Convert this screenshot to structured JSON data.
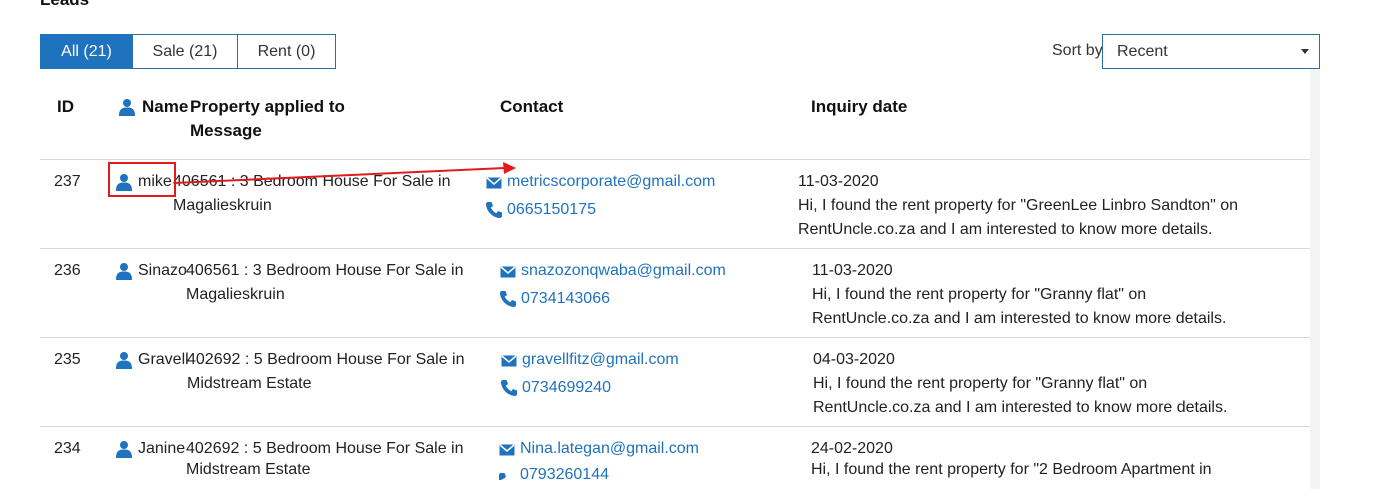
{
  "page_title": "Leads",
  "tabs": [
    {
      "label": "All (21)",
      "active": true
    },
    {
      "label": "Sale (21)",
      "active": false
    },
    {
      "label": "Rent (0)",
      "active": false
    }
  ],
  "sort": {
    "label": "Sort by",
    "selected": "Recent"
  },
  "columns": {
    "id": "ID",
    "name": "Name",
    "property": "Property applied to",
    "message": "Message",
    "contact": "Contact",
    "inquiry_date": "Inquiry date"
  },
  "rows": [
    {
      "id": "237",
      "name": "mike",
      "property_line1": "406561 : 3 Bedroom House For Sale in",
      "property_line2": "Magalieskruin",
      "email": "metricscorporate@gmail.com",
      "phone": "0665150175",
      "date": "11-03-2020",
      "message_line1": "Hi, I found the rent property for \"GreenLee Linbro Sandton\" on",
      "message_line2": "RentUncle.co.za and I am interested to know more details."
    },
    {
      "id": "236",
      "name": "Sinazo",
      "property_line1": "406561 : 3 Bedroom House For Sale in",
      "property_line2": "Magalieskruin",
      "email": "snazozonqwaba@gmail.com",
      "phone": "0734143066",
      "date": "11-03-2020",
      "message_line1": "Hi, I found the rent property for \"Granny flat\" on",
      "message_line2": "RentUncle.co.za and I am interested to know more details."
    },
    {
      "id": "235",
      "name": "Gravell",
      "property_line1": "402692 : 5 Bedroom House For Sale in",
      "property_line2": "Midstream Estate",
      "email": "gravellfitz@gmail.com",
      "phone": "0734699240",
      "date": "04-03-2020",
      "message_line1": "Hi, I found the rent property for \"Granny flat\" on",
      "message_line2": "RentUncle.co.za and I am interested to know more details."
    },
    {
      "id": "234",
      "name": "Janine",
      "property_line1": "402692 : 5 Bedroom House For Sale in",
      "property_line2": "Midstream Estate",
      "email": "Nina.lategan@gmail.com",
      "phone": "0793260144",
      "date": "24-02-2020",
      "message_line1": "Hi, I found the rent property for \"2 Bedroom Apartment in",
      "message_line2": ""
    }
  ],
  "colors": {
    "accent": "#1f72bd",
    "annotation": "#e01b1b",
    "panel": "#f2f3f5"
  },
  "icons": [
    "user-icon",
    "mail-icon",
    "phone-icon",
    "chevron-down-icon"
  ]
}
